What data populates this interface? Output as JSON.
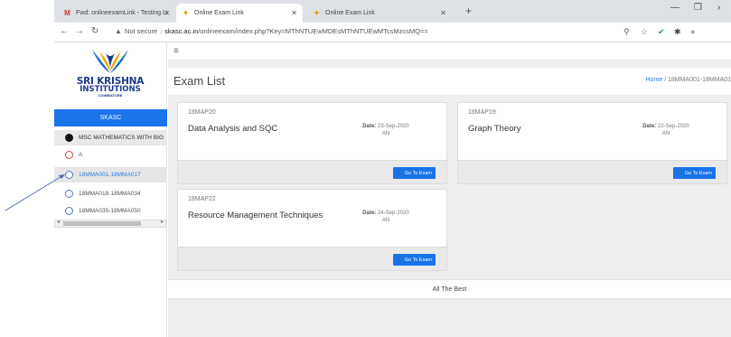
{
  "browser": {
    "tabs": [
      {
        "title": "Fwd: onlineexamLink - Testing Li",
        "icon": "gmail-icon"
      },
      {
        "title": "Online Exam Link",
        "icon": "srikrishna-favicon"
      },
      {
        "title": "Online Exam Link",
        "icon": "srikrishna-favicon"
      }
    ],
    "url_warning": "Not secure",
    "url_host": "skasc.ac.in",
    "url_path": "/onlineexam/index.php?Key=MThNTUEwMDEsMThNTUEwMTcsMzcsMQ=="
  },
  "sidebar": {
    "brand_line1": "SRI KRISHNA",
    "brand_line2": "INSTITUTIONS",
    "brand_line3": "COIMBATORE",
    "college_button": "SKASC",
    "department": "MSC MATHEMATICS WITH BIG",
    "options": [
      {
        "label": "A"
      },
      {
        "label": "18MMA001-18MMA017"
      },
      {
        "label": "18MMA018-18MMA034"
      },
      {
        "label": "18MMA035-18MMA050"
      }
    ]
  },
  "header": {
    "title": "Exam List",
    "breadcrumb_home": "Home",
    "breadcrumb_sep": "/",
    "breadcrumb_current": "18MMA001-18MMA01"
  },
  "exams": [
    {
      "code": "18MAP20",
      "name": "Data Analysis and SQC",
      "date_label": "Date:",
      "date": "23-Sep-2020",
      "session": "AN",
      "button": "Go To Exam"
    },
    {
      "code": "18MAP19",
      "name": "Graph Theory",
      "date_label": "Date:",
      "date": "22-Sep-2020",
      "session": "AN",
      "button": "Go To Exam"
    },
    {
      "code": "18MAP22",
      "name": "Resource Management Techniques",
      "date_label": "Date:",
      "date": "24-Sep-2020",
      "session": "AN",
      "button": "Go To Exam"
    }
  ],
  "footer": {
    "text": "All The Best"
  },
  "colors": {
    "accent": "#1a73e8",
    "brand": "#1b3b8b",
    "selected_link": "#2d7be0",
    "radio_red": "#d9443a"
  }
}
